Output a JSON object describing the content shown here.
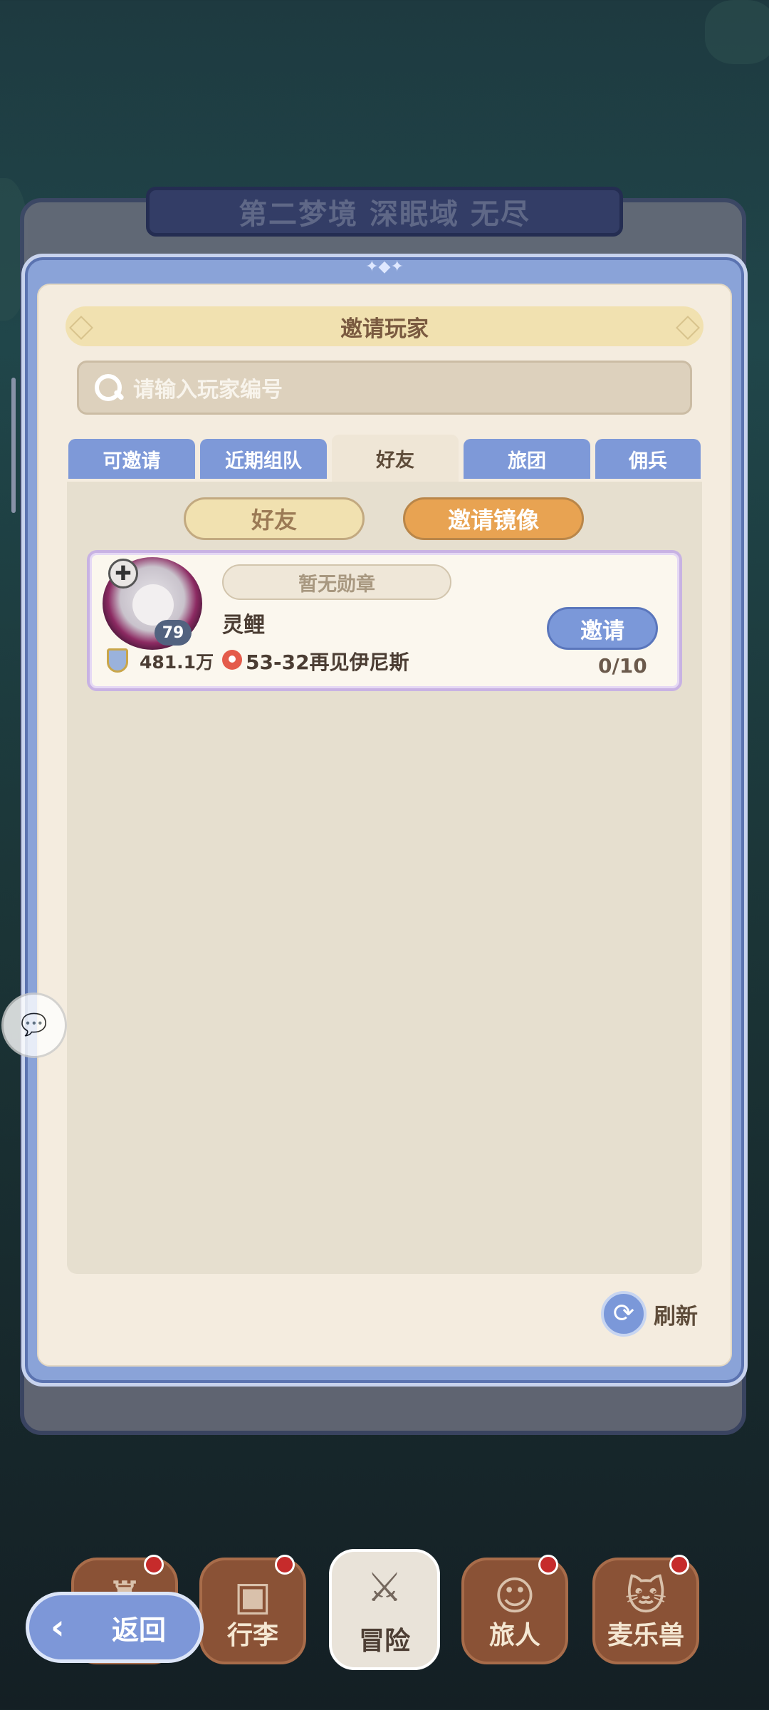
{
  "header": {
    "dream_title": "第二梦境  深眠域  无尽"
  },
  "panel": {
    "title": "邀请玩家"
  },
  "search": {
    "placeholder": "请输入玩家编号"
  },
  "tabs": [
    {
      "label": "可邀请",
      "active": false
    },
    {
      "label": "近期组队",
      "active": false
    },
    {
      "label": "好友",
      "active": true
    },
    {
      "label": "旅团",
      "active": false
    },
    {
      "label": "佣兵",
      "active": false
    }
  ],
  "subtabs": {
    "friend": "好友",
    "mirror": "邀请镜像"
  },
  "players": [
    {
      "level": "79",
      "medal": "暂无勋章",
      "name": "灵鲤",
      "power": "481.1万",
      "location": "53-32再见伊尼斯",
      "invite_label": "邀请",
      "count": "0/10"
    }
  ],
  "refresh": {
    "label": "刷新"
  },
  "bottom_nav": {
    "back": "返回",
    "items": [
      {
        "label": "行李"
      },
      {
        "label": "冒险"
      },
      {
        "label": "旅人"
      },
      {
        "label": "麦乐兽"
      }
    ]
  },
  "colors": {
    "accent_blue": "#7b98d9",
    "accent_orange": "#e8a352",
    "panel_bg": "#f4ecdf"
  }
}
